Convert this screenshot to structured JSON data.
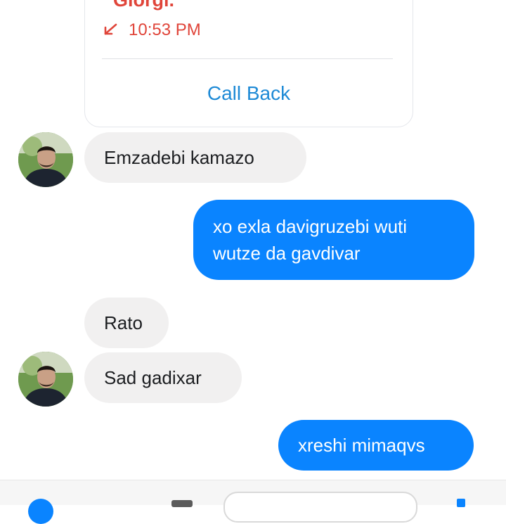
{
  "call_card": {
    "caller_name": "Giorgi.",
    "time": "10:53 PM",
    "time_icon": "missed-call-arrow-icon",
    "call_back_label": "Call Back"
  },
  "messages": [
    {
      "direction": "received",
      "text": "Emzadebi kamazo"
    },
    {
      "direction": "sent",
      "text_line1": "xo exla davigruzebi wuti",
      "text_line2": "wutze da gavdivar"
    },
    {
      "direction": "received",
      "text": "Rato"
    },
    {
      "direction": "received",
      "text": "Sad gadixar"
    },
    {
      "direction": "sent",
      "text": "xreshi mimaqvs"
    }
  ],
  "colors": {
    "sent_bubble": "#0a84ff",
    "received_bubble": "#f1f0f0",
    "missed_call": "#e0453a",
    "link": "#1e8ad6"
  }
}
